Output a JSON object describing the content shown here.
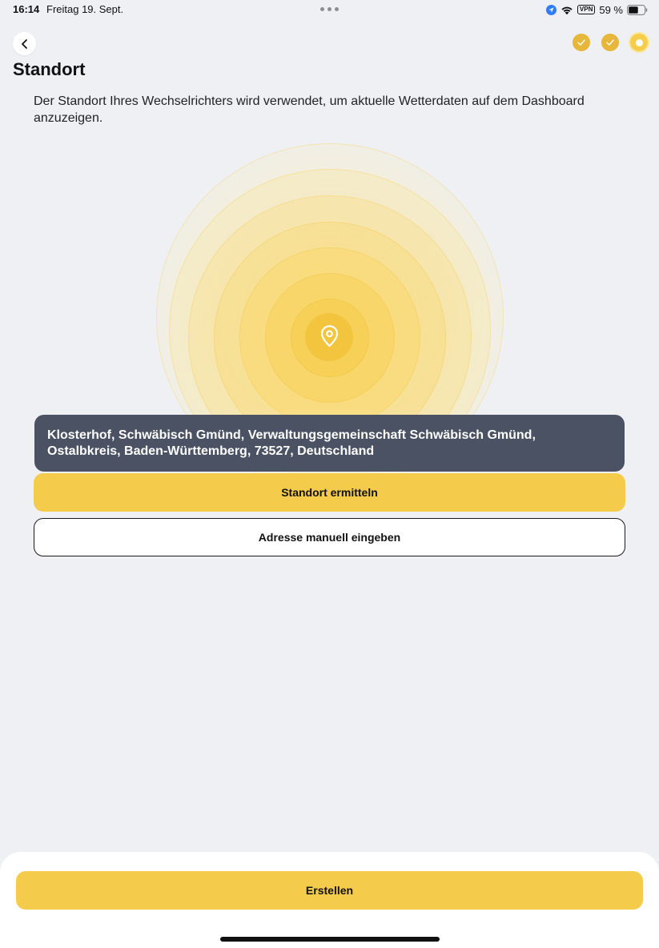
{
  "status_bar": {
    "time": "16:14",
    "date": "Freitag 19. Sept.",
    "vpn": "VPN",
    "battery": "59 %"
  },
  "header": {
    "title": "Standort",
    "back_icon": "chevron-left-icon",
    "steps": [
      {
        "state": "done",
        "icon": "check-icon"
      },
      {
        "state": "done",
        "icon": "check-icon"
      },
      {
        "state": "current",
        "icon": "dot-icon"
      }
    ]
  },
  "main": {
    "description": "Der Standort Ihres Wechselrichters wird verwendet, um aktuelle Wetterdaten auf dem Dashboard anzuzeigen.",
    "pin_icon": "location-pin-icon",
    "address": "Klosterhof, Schwäbisch Gmünd, Verwaltungsgemeinschaft Schwäbisch Gmünd, Ostalbkreis, Baden-Württemberg, 73527, Deutschland",
    "locate_button": "Standort ermitteln",
    "manual_button": "Adresse manuell eingeben"
  },
  "footer": {
    "create_button": "Erstellen"
  },
  "colors": {
    "accent": "#f5cb4c",
    "step_done": "#e6b73a",
    "address_card": "#4a5263",
    "background": "#eef0f4"
  }
}
